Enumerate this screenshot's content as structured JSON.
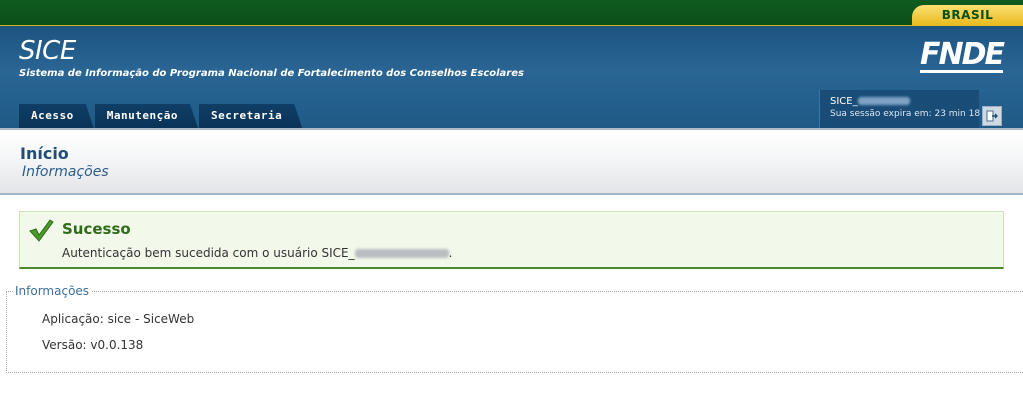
{
  "gov_bar": {
    "badge": "BRASIL"
  },
  "header": {
    "title": "SICE",
    "subtitle": "Sistema de Informação do Programa Nacional de Fortalecimento dos Conselhos Escolares",
    "logo_text": "FNDE",
    "nav": [
      {
        "label": "Acesso"
      },
      {
        "label": "Manutenção"
      },
      {
        "label": "Secretaria"
      }
    ],
    "session": {
      "user_prefix": "SICE_",
      "expire_text": "Sua sessão expira em: 23 min 18"
    }
  },
  "page": {
    "title": "Início",
    "subtitle": "Informações"
  },
  "success": {
    "title": "Sucesso",
    "text_prefix": "Autenticação bem sucedida com o usuário SICE_",
    "text_suffix": "."
  },
  "info": {
    "legend": "Informações",
    "application": "Aplicação: sice - SiceWeb",
    "version": "Versão: v0.0.138"
  },
  "colors": {
    "gov_green": "#0b4f1a",
    "header_blue": "#2a6594",
    "success_green": "#2f6b1a"
  }
}
